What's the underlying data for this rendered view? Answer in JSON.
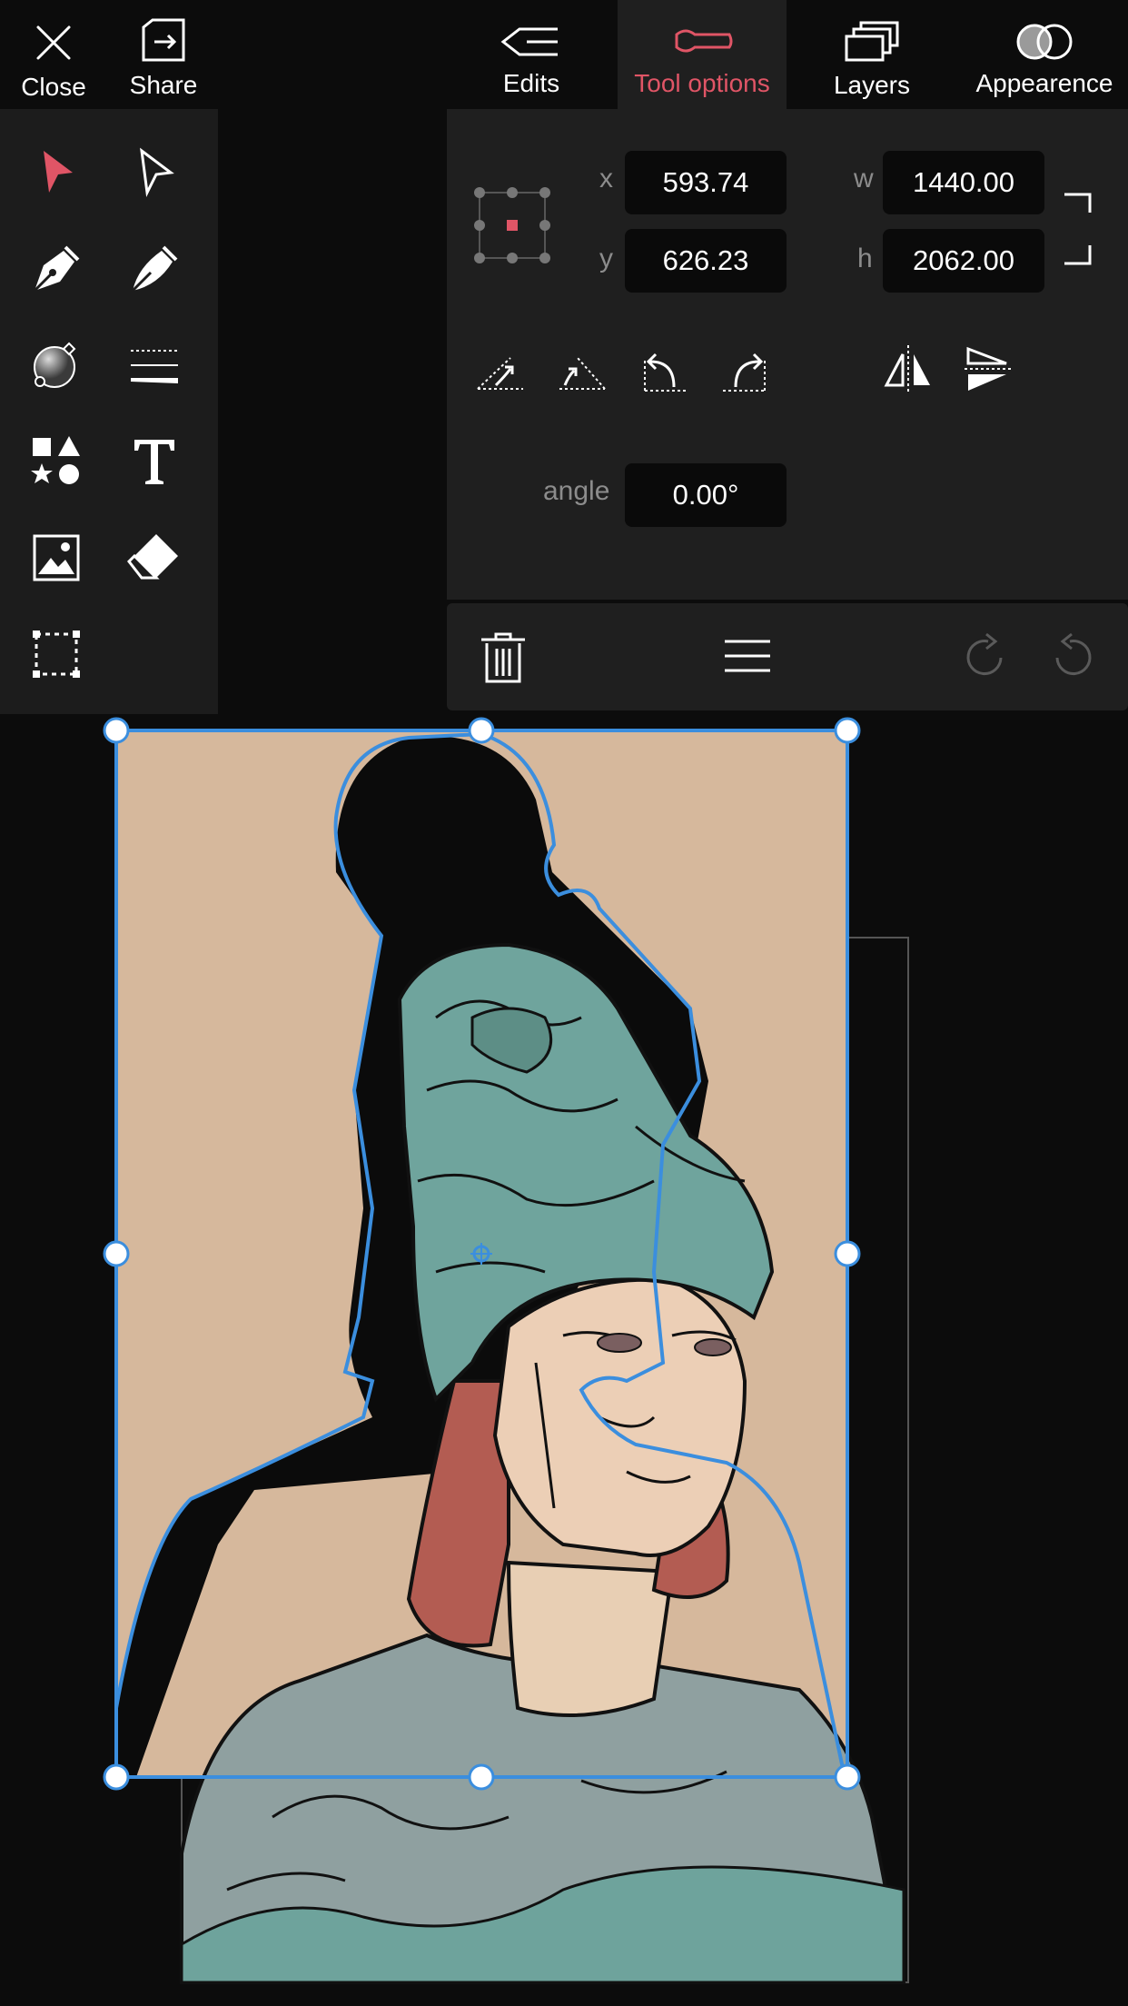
{
  "topbar": {
    "close_label": "Close",
    "share_label": "Share",
    "tabs": [
      {
        "label": "Edits"
      },
      {
        "label": "Tool options"
      },
      {
        "label": "Layers"
      },
      {
        "label": "Appearence"
      }
    ],
    "active_tab": "Tool options"
  },
  "tools": [
    {
      "icon": "select-arrow-icon",
      "active": true
    },
    {
      "icon": "direct-select-icon",
      "active": false
    },
    {
      "icon": "pen-tool-icon",
      "active": false
    },
    {
      "icon": "brush-pen-icon",
      "active": false
    },
    {
      "icon": "gradient-fill-icon",
      "active": false
    },
    {
      "icon": "stroke-width-icon",
      "active": false
    },
    {
      "icon": "shapes-icon",
      "active": false
    },
    {
      "icon": "text-tool-icon",
      "active": false
    },
    {
      "icon": "image-icon",
      "active": false
    },
    {
      "icon": "eraser-icon",
      "active": false
    },
    {
      "icon": "marquee-select-icon",
      "active": false
    }
  ],
  "tool_options": {
    "x_label": "x",
    "x_value": "593.74",
    "y_label": "y",
    "y_value": "626.23",
    "w_label": "w",
    "w_value": "1440.00",
    "h_label": "h",
    "h_value": "2062.00",
    "angle_label": "angle",
    "angle_value": "0.00°",
    "transform_icons": [
      "skew-left-icon",
      "skew-right-icon",
      "rotate-ccw-icon",
      "rotate-cw-icon",
      "flip-horizontal-icon",
      "flip-vertical-icon"
    ],
    "action_icons": [
      "trash-icon",
      "menu-icon",
      "redo-icon",
      "undo-icon"
    ]
  },
  "colors": {
    "accent": "#e05566",
    "selection": "#3b8ede",
    "panel": "#1f1f1f",
    "canvas_bg": "#d6b89c"
  }
}
